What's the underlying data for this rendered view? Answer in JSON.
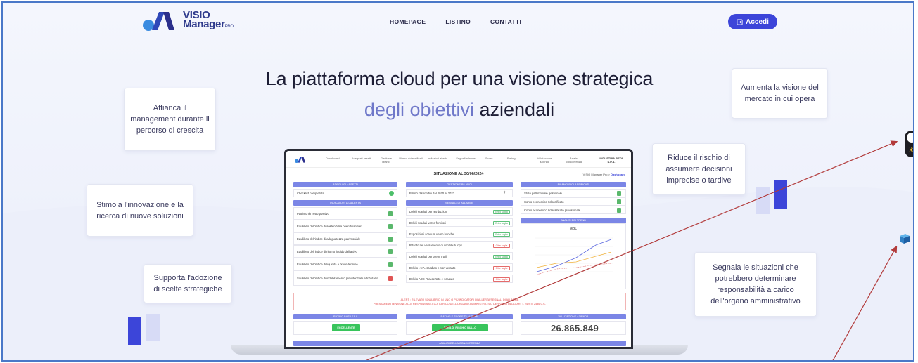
{
  "brand": {
    "logo_line1": "VISIO",
    "logo_line2": "Manager",
    "logo_suffix": "PRO"
  },
  "nav": {
    "homepage": "HOMEPAGE",
    "listino": "LISTINO",
    "contatti": "CONTATTI"
  },
  "login": {
    "label": "Accedi",
    "icon": "login-icon"
  },
  "hero": {
    "line1": "La piattaforma cloud per una visione strategica",
    "line2_highlight": "degli obiettivi",
    "line2_rest": " aziendali"
  },
  "cards": {
    "affianca": "Affianca il management durante il percorso di crescita",
    "aumenta": "Aumenta la visione del mercato in cui opera",
    "riduce": "Riduce il rischio di assumere decisioni imprecise o tardive",
    "stimola": "Stimola l'innovazione e la ricerca di nuove soluzioni",
    "supporta": "Supporta l'adozione di scelte strategiche",
    "segnala": "Segnala le situazioni che potrebbero determinare responsabilità a carico dell'organo amministrativo"
  },
  "dashboard": {
    "menu": [
      "Dashboard",
      "Adeguati assetti",
      "Gestione bilanci",
      "Bilanci riclassificati",
      "Indicatori allerta",
      "Segnali allarme",
      "Score",
      "Rating",
      "Valutazione azienda",
      "Analisi concorrenza",
      "INDUSTRIA BETA S.P.A."
    ],
    "title": "SITUAZIONE AL 30/06/2024",
    "crumb_pre": "VISIO Manager Pro  >  ",
    "crumb_active": "Dashboard",
    "panels": {
      "assetti_hdr": "ADEGUATI ASSETTI",
      "assetti_row": "Checklist completata",
      "indicatori_hdr": "INDICATORI DI ALLERTA",
      "indicatori": [
        "Patrimonio netto positivo",
        "Equilibrio dell'indice di sostenibilità oneri finanziari",
        "Equilibrio dell'indice di adeguatezza patrimoniale",
        "Equilibrio dell'indice di ritorno liquido dell'attivo",
        "Equilibrio dell'indice di liquidità a breve termine",
        "Squilibrio dell'indice di indebitamento previdenziale e tributario"
      ],
      "bilanci_hdr": "GESTIONE BILANCI",
      "bilanci_row": "Bilanci disponibili dal 2020 al 2023",
      "segnali_hdr": "SEGNALI DI ALLARME",
      "segnali": [
        {
          "label": "Debiti scaduti per retribuzioni",
          "pill": "Entro soglia",
          "ok": true
        },
        {
          "label": "Debiti scaduti verso fornitori",
          "pill": "Entro soglia",
          "ok": true
        },
        {
          "label": "Esposizioni scadute verso banche",
          "pill": "Entro soglia",
          "ok": true
        },
        {
          "label": "Ritardo nei versamento di contributi Inps",
          "pill": "Oltre soglia",
          "ok": false
        },
        {
          "label": "Debiti scaduti per premi Inail",
          "pill": "Entro soglia",
          "ok": true
        },
        {
          "label": "Debito I.V.A. scaduto e non versato",
          "pill": "Oltre soglia",
          "ok": false
        },
        {
          "label": "Debito ADE-R accertato e scaduto",
          "pill": "Oltre soglia",
          "ok": false
        }
      ],
      "riclass_hdr": "BILANCI RICLASSIFICATI",
      "riclass": [
        "Stato patrimoniale gestionale",
        "Conto economico riclassificato",
        "Conto economico riclassificato previsionale"
      ],
      "trend_hdr": "ANALISI DEI TREND",
      "trend_title": "MOL"
    },
    "alert_line1": "ALERT : RILEVATO SQUILIBRIO IN UNO O PIÙ INDICATORI DI ALLERTA/SEGNALI DI ALLARME",
    "alert_line2": "PRESTARE ATTENZIONE ALLE RESPONSABILITÀ A CARICO DELL'ORGANO AMMINISTRATIVO DERIVANTI DAGLI ARTT. 2476 E 2486 C.C.",
    "rating_hdr": "RATING BASILEA II",
    "rating_val": "ECCELLENTE",
    "score_hdr": "RATING E SCORE DI ALTMAN",
    "score_val": "ZONA DI RISCHIO NULLO",
    "valutazione_hdr": "VALUTAZIONE AZIENDA",
    "valutazione_val": "26.865.849",
    "concorrenza_hdr": "ANALISI DELLA CONCORRENZA"
  },
  "colors": {
    "accent": "#3c45d9",
    "panel": "#7b86e6",
    "highlight": "#6f78c9",
    "annotation_arrow": "#b23a3a"
  },
  "icons": {
    "theme": "sun-icon",
    "side": "book-icon"
  }
}
